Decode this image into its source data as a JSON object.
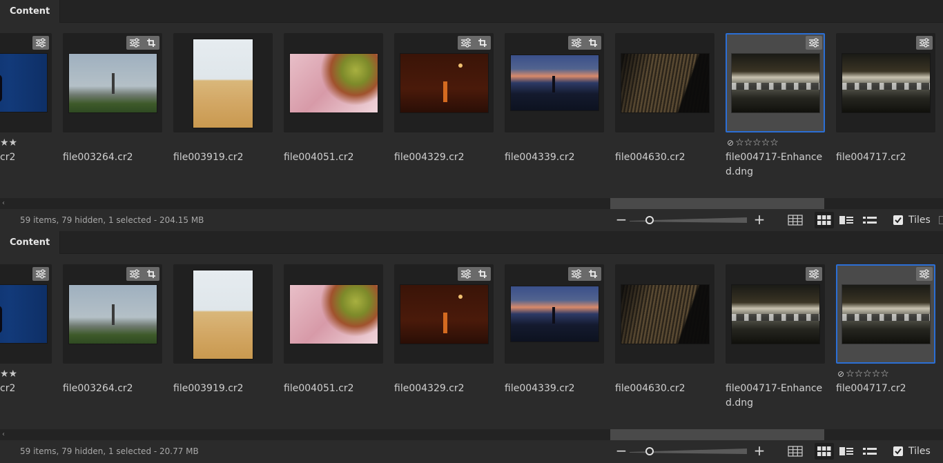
{
  "theme": {
    "accent": "#2b6fd6",
    "background": "#2b2b2b"
  },
  "panels": [
    {
      "tab_label": "Content",
      "status": "59 items, 79 hidden, 1 selected - 204.15 MB",
      "selected_file": "file004717-Enhanced.dng",
      "tiles_label": "Tiles",
      "tiles_checked": true,
      "tiles": [
        {
          "name": "cr2",
          "rating": "★★",
          "badges": [
            "adjust-icon"
          ]
        },
        {
          "name": "file003264.cr2",
          "rating": "",
          "badges": [
            "adjust-icon",
            "crop-icon"
          ]
        },
        {
          "name": "file003919.cr2",
          "rating": "",
          "badges": []
        },
        {
          "name": "file004051.cr2",
          "rating": "",
          "badges": []
        },
        {
          "name": "file004329.cr2",
          "rating": "",
          "badges": [
            "adjust-icon",
            "crop-icon"
          ]
        },
        {
          "name": "file004339.cr2",
          "rating": "",
          "badges": [
            "adjust-icon",
            "crop-icon"
          ]
        },
        {
          "name": "file004630.cr2",
          "rating": "",
          "badges": []
        },
        {
          "name": "file004717-Enhanced.dng",
          "rating": "☆☆☆☆☆",
          "badges": [
            "adjust-icon"
          ],
          "selected": true
        },
        {
          "name": "file004717.cr2",
          "rating": "",
          "badges": [
            "adjust-icon"
          ]
        }
      ]
    },
    {
      "tab_label": "Content",
      "status": "59 items, 79 hidden, 1 selected - 20.77 MB",
      "selected_file": "file004717.cr2",
      "tiles_label": "Tiles",
      "tiles_checked": true,
      "tiles": [
        {
          "name": "cr2",
          "rating": "★★",
          "badges": [
            "adjust-icon"
          ]
        },
        {
          "name": "file003264.cr2",
          "rating": "",
          "badges": [
            "adjust-icon",
            "crop-icon"
          ]
        },
        {
          "name": "file003919.cr2",
          "rating": "",
          "badges": []
        },
        {
          "name": "file004051.cr2",
          "rating": "",
          "badges": []
        },
        {
          "name": "file004329.cr2",
          "rating": "",
          "badges": [
            "adjust-icon",
            "crop-icon"
          ]
        },
        {
          "name": "file004339.cr2",
          "rating": "",
          "badges": [
            "adjust-icon",
            "crop-icon"
          ]
        },
        {
          "name": "file004630.cr2",
          "rating": "",
          "badges": []
        },
        {
          "name": "file004717-Enhanced.dng",
          "rating": "",
          "badges": [
            "adjust-icon"
          ]
        },
        {
          "name": "file004717.cr2",
          "rating": "☆☆☆☆☆",
          "badges": [
            "adjust-icon"
          ],
          "selected": true
        }
      ]
    }
  ]
}
